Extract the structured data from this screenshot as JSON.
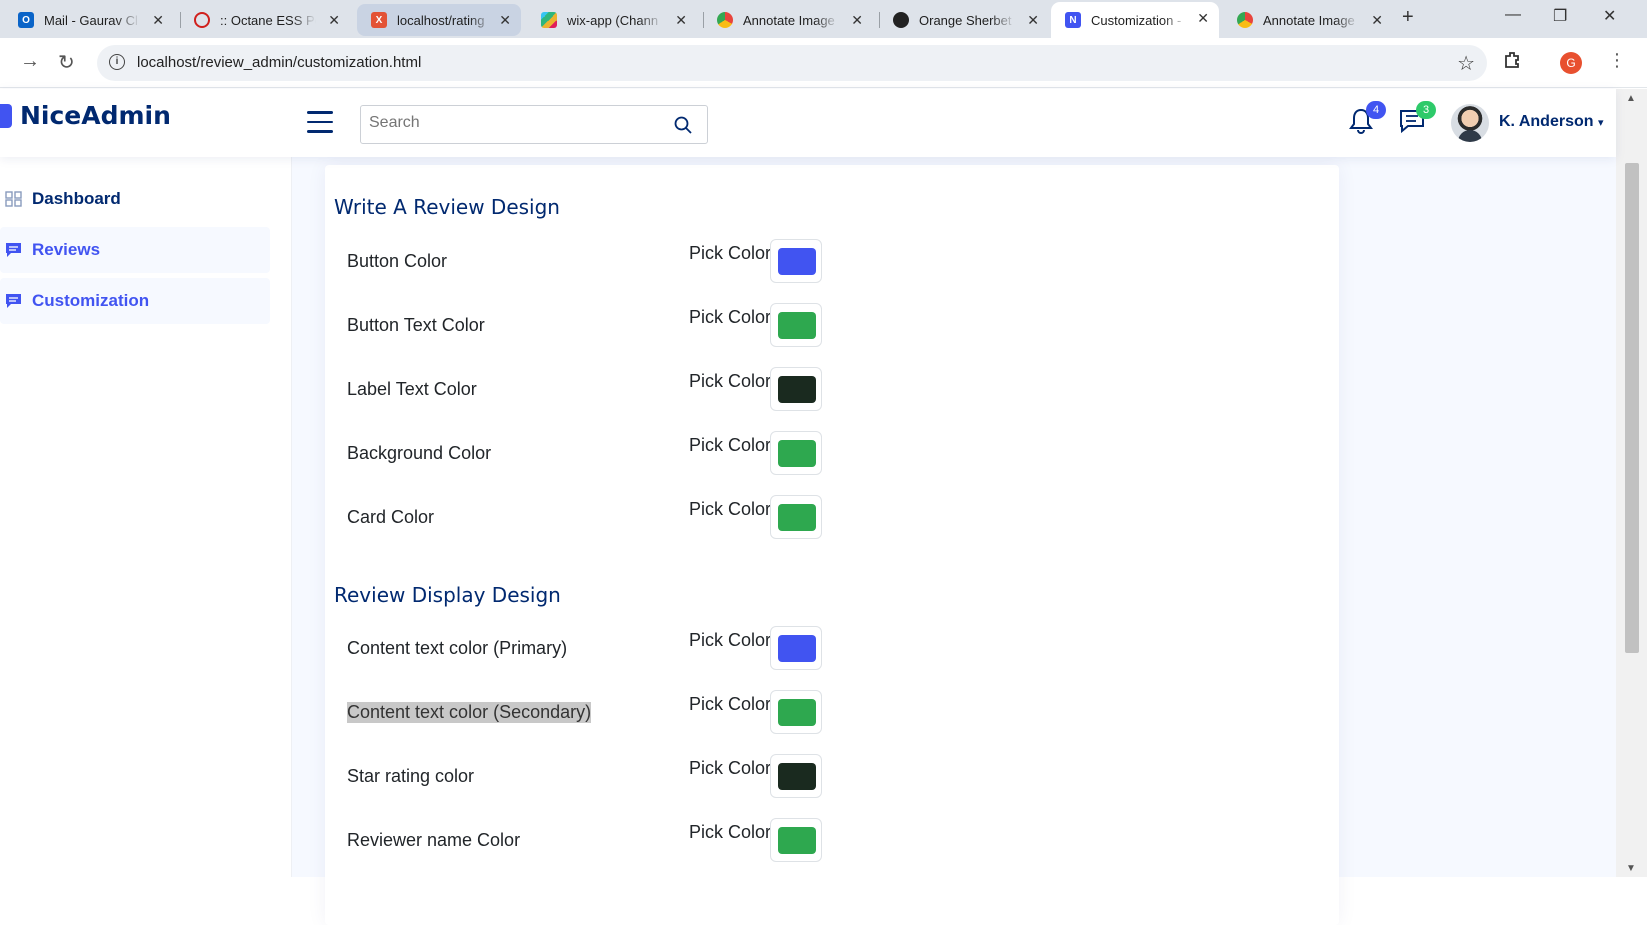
{
  "browser": {
    "tabs": [
      {
        "title": "Mail - Gaurav Cl",
        "icon_color": "#0a64c8",
        "icon": "outlook-icon"
      },
      {
        "title": ":: Octane ESS Po",
        "icon_color": "#d0201d",
        "icon": "opera-icon"
      },
      {
        "title": "localhost/rating",
        "icon_color": "#e35336",
        "icon": "xampp-icon"
      },
      {
        "title": "wix-app (Chann",
        "icon_color": "#611f69",
        "icon": "slack-icon"
      },
      {
        "title": "Annotate Image",
        "icon_color": "#e8453c",
        "icon": "chrome-icon"
      },
      {
        "title": "Orange Sherbet",
        "icon_color": "#222222",
        "icon": "github-icon"
      },
      {
        "title": "Customization -",
        "icon_color": "#4154f1",
        "icon": "niceadmin-icon"
      },
      {
        "title": "Annotate Image",
        "icon_color": "#e8453c",
        "icon": "chrome-icon"
      }
    ],
    "url": "localhost/review_admin/customization.html",
    "profile_initial": "G"
  },
  "header": {
    "logo": "NiceAdmin",
    "search_placeholder": "Search",
    "notifications_count": "4",
    "messages_count": "3",
    "user_name": "K. Anderson"
  },
  "sidebar": {
    "items": [
      {
        "label": "Dashboard"
      },
      {
        "label": "Reviews"
      },
      {
        "label": "Customization"
      }
    ]
  },
  "main": {
    "write_section": {
      "title": "Write A Review Design",
      "rows": [
        {
          "label": "Button Color",
          "pick": "Pick Color",
          "color": "#4154f1"
        },
        {
          "label": "Button Text Color",
          "pick": "Pick Color",
          "color": "#2ea84f"
        },
        {
          "label": "Label Text Color",
          "pick": "Pick Color",
          "color": "#1a2a1f"
        },
        {
          "label": "Background Color",
          "pick": "Pick Color",
          "color": "#2ea84f"
        },
        {
          "label": "Card Color",
          "pick": "Pick Color",
          "color": "#2ea84f"
        }
      ]
    },
    "display_section": {
      "title": "Review Display Design",
      "rows": [
        {
          "label": "Content text color (Primary)",
          "pick": "Pick Color",
          "color": "#4154f1"
        },
        {
          "label": "Content text color (Secondary)",
          "pick": "Pick Color",
          "color": "#2ea84f"
        },
        {
          "label": "Star rating color",
          "pick": "Pick Color",
          "color": "#1a2a1f"
        },
        {
          "label": "Reviewer name Color",
          "pick": "Pick Color",
          "color": "#2ea84f"
        }
      ]
    }
  }
}
